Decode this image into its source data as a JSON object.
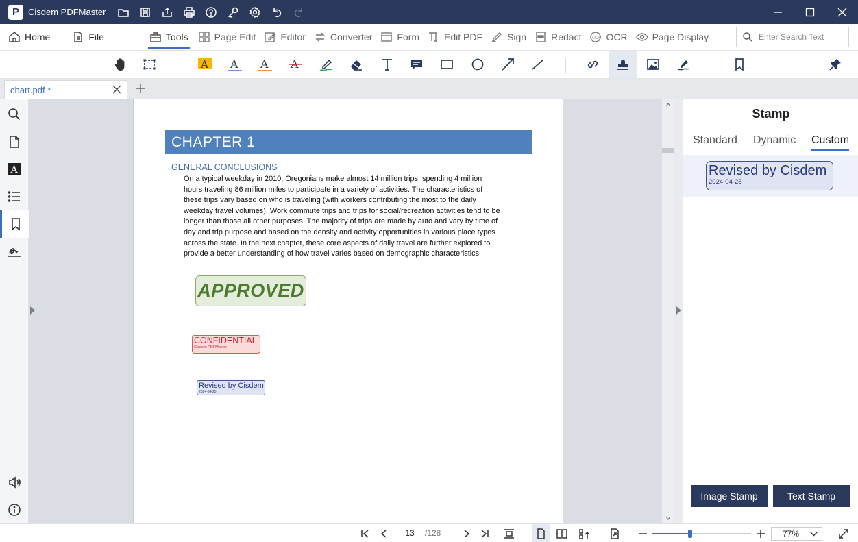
{
  "app": {
    "title": "Cisdem PDFMaster",
    "logo_letter": "P",
    "brand_color": "#2b3a5c",
    "accent_color": "#3a6fc2"
  },
  "titlebar_icons": [
    "open-folder-icon",
    "save-icon",
    "share-icon",
    "print-icon",
    "help-icon",
    "key-icon",
    "settings-icon",
    "undo-icon",
    "redo-icon"
  ],
  "menu": {
    "home": "Home",
    "file": "File",
    "tools": "Tools",
    "page_edit": "Page Edit",
    "editor": "Editor",
    "converter": "Converter",
    "form": "Form",
    "edit_pdf": "Edit PDF",
    "sign": "Sign",
    "redact": "Redact",
    "ocr": "OCR",
    "page_display": "Page Display",
    "active": "Tools"
  },
  "search": {
    "placeholder": "Enter Search Text",
    "value": ""
  },
  "toolbar": {
    "tools": [
      "hand-icon",
      "select-area-icon",
      "highlight-text-icon",
      "underline-icon",
      "squiggly-icon",
      "strikethrough-icon",
      "pen-icon",
      "eraser-icon",
      "text-box-icon",
      "comment-icon",
      "rectangle-icon",
      "ellipse-icon",
      "arrow-icon",
      "line-icon",
      "link-icon",
      "stamp-icon",
      "image-icon",
      "signature-icon",
      "bookmark-icon",
      "pin-icon"
    ],
    "selected": "stamp-icon"
  },
  "tab": {
    "label": "chart.pdf *"
  },
  "left_sidebar": {
    "items": [
      "search-icon",
      "page-icon",
      "text-icon",
      "outline-icon",
      "bookmark-icon",
      "signature-icon"
    ],
    "bottom": [
      "speaker-icon",
      "info-icon"
    ],
    "active": "bookmark-icon"
  },
  "document": {
    "chapter_title": "CHAPTER 1",
    "section_heading": "GENERAL CONCLUSIONS",
    "paragraph_lines": [
      "On a typical weekday in 2010, Oregonians make almost 14 million trips, spending 4 million",
      "hours traveling 86 million miles to participate in a variety of activities. The characteristics of",
      "these trips vary based on who is traveling (with workers contributing the most to the daily",
      "weekday travel volumes). Work commute trips and trips for social/recreation activities tend to be",
      "longer than those all other purposes. The majority of trips are made by auto and vary by time of",
      "day and trip purpose and based on the density and activity opportunities in various place types",
      "across the state. In the next chapter, these core aspects of daily travel are further explored to",
      "provide a better understanding of how travel varies based on demographic characteristics."
    ],
    "stamps": {
      "approved": "APPROVED",
      "confidential": "CONFIDENTIAL",
      "confidential_sub": "Cisdem PDFMaster",
      "revised": "Revised by Cisdem",
      "revised_date": "2024-04-25"
    }
  },
  "stamp_panel": {
    "title": "Stamp",
    "tabs": [
      "Standard",
      "Dynamic",
      "Custom"
    ],
    "active_tab": "Custom",
    "custom_stamps": [
      {
        "text": "Revised by Cisdem",
        "date": "2024-04-25"
      }
    ],
    "image_stamp_button": "Image Stamp",
    "text_stamp_button": "Text Stamp"
  },
  "statusbar": {
    "current_page": "13",
    "total_pages": "/128",
    "zoom": "77%",
    "zoom_level": 0.38
  }
}
